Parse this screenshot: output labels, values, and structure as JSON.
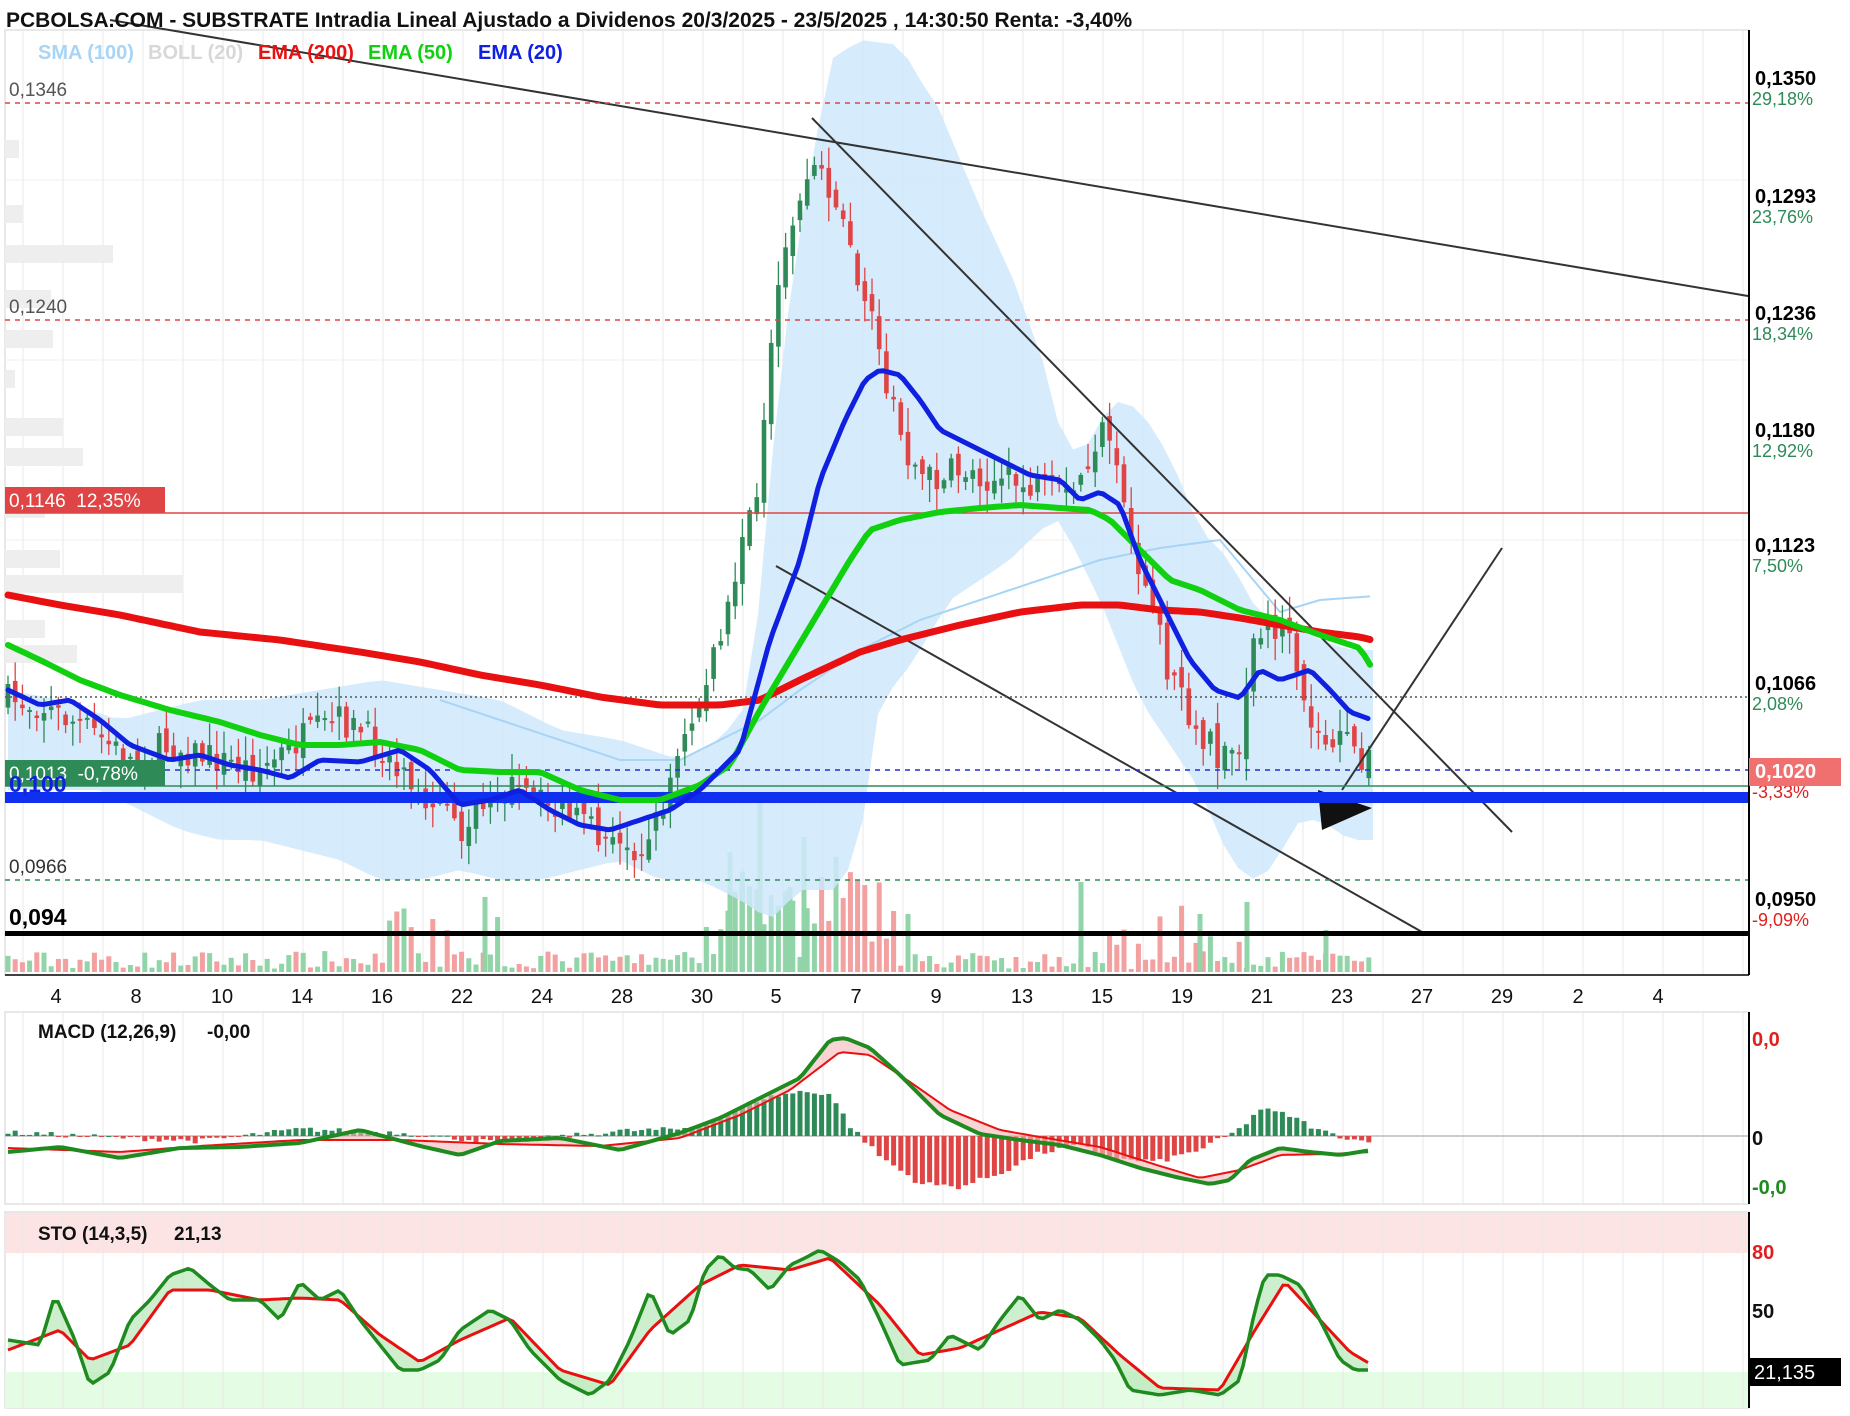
{
  "header": {
    "title": "PCBOLSA.COM - SUBSTRATE Intradia Lineal Ajustado a Dividenos 20/3/2025 - 23/5/2025 , 14:30:50 Renta: -3,40%"
  },
  "legend": [
    {
      "label": "SMA (100)",
      "color": "#a8d4f5"
    },
    {
      "label": "BOLL (20)",
      "color": "#d8d8d8"
    },
    {
      "label": "EMA (200)",
      "color": "#e81010"
    },
    {
      "label": "EMA (50)",
      "color": "#10d010"
    },
    {
      "label": "EMA (20)",
      "color": "#1020e0"
    }
  ],
  "colors": {
    "up": "#2e8b57",
    "down": "#e04545",
    "ema200": "#e81010",
    "ema50": "#10d010",
    "ema20": "#1020e0",
    "boll_fill": "#cfe8fb",
    "volume_up": "#90d4a8",
    "volume_down": "#f2a0a0",
    "macd_line": "#1f8a1f",
    "macd_signal": "#e81010",
    "pct_green": "#2e8b57",
    "pct_red": "#e02020"
  },
  "price_axis": {
    "ticks": [
      {
        "price": "0,1350",
        "pct": "29,18%"
      },
      {
        "price": "0,1293",
        "pct": "23,76%"
      },
      {
        "price": "0,1236",
        "pct": "18,34%"
      },
      {
        "price": "0,1180",
        "pct": "12,92%"
      },
      {
        "price": "0,1123",
        "pct": "7,50%"
      },
      {
        "price": "0,1066",
        "pct": "2,08%"
      },
      {
        "price": "0,1020",
        "pct": "-3,33%"
      },
      {
        "price": "0,0950",
        "pct": "-9,09%"
      }
    ]
  },
  "left_levels": {
    "l1346": "0,1346",
    "l1240": "0,1240",
    "l1146": "0,1146  12,35%",
    "l1013": "0,1013  -0,78%",
    "l100": "0,100",
    "l0966": "0,0966",
    "l094": "0,094"
  },
  "x_axis": {
    "labels": [
      "4",
      "8",
      "10",
      "14",
      "16",
      "22",
      "24",
      "28",
      "30",
      "5",
      "7",
      "9",
      "13",
      "15",
      "19",
      "21",
      "23",
      "27",
      "29",
      "2",
      "4"
    ]
  },
  "macd": {
    "label": "MACD (12,26,9)",
    "value": "-0,00",
    "axis_top": "0,0",
    "axis_mid": "0",
    "axis_bottom": "-0,0"
  },
  "sto": {
    "label": "STO (14,3,5)",
    "value": "21,13",
    "axis_80": "80",
    "axis_50": "50",
    "current": "21,135"
  },
  "chart_data": {
    "type": "candlestick",
    "symbol": "SUBSTRATE",
    "period": "20/3/2025 - 23/5/2025",
    "return": "-3,40%",
    "price_range": [
      0.094,
      0.136
    ],
    "last_price": 0.102,
    "series": [
      {
        "name": "EMA (200)",
        "start": 0.1085,
        "mid": 0.1045,
        "peak": 0.1095,
        "end": 0.1078
      },
      {
        "name": "EMA (50)",
        "start": 0.107,
        "low": 0.1,
        "peak": 0.1145,
        "end": 0.106
      },
      {
        "name": "EMA (20)",
        "start": 0.105,
        "low": 0.0985,
        "peak": 0.121,
        "end": 0.1035
      }
    ],
    "horizontal_levels": [
      0.1346,
      0.124,
      0.1146,
      0.1066,
      0.102,
      0.1013,
      0.1,
      0.0966,
      0.094
    ],
    "macd": {
      "current": -0.0
    },
    "sto": {
      "current": 21.135,
      "levels": [
        80,
        50,
        20
      ]
    }
  }
}
